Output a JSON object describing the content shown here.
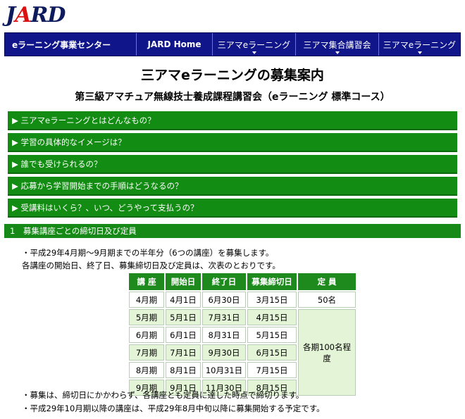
{
  "logo": "JARD",
  "nav": {
    "brand": "eラーニング事業センター",
    "items": [
      "JARD Home",
      "三アマeラーニング",
      "三アマ集合講習会",
      "三アマeラーニング"
    ]
  },
  "title": "三アマeラーニングの募集案内",
  "subtitle": "第三級アマチュア無線技士養成課程講習会（eラーニング 標準コース）",
  "accordion": [
    "▶ 三アマeラーニングとはどんなもの？",
    "▶ 学習の具体的なイメージは？",
    "▶ 誰でも受けられるの？",
    "▶ 応募から学習開始までの手順はどうなるの？",
    "▶ 受講料はいくら？、いつ、どうやって支払うの？"
  ],
  "section_title": "1　募集講座ごとの締切日及び定員",
  "intro": [
    "・平成29年4月期〜9月期までの半年分（6つの講座）を募集します。",
    "各講座の開始日、終了日、募集締切日及び定員は、次表のとおりです。"
  ],
  "table": {
    "headers": [
      "講 座",
      "開始日",
      "終了日",
      "募集締切日",
      "定 員"
    ],
    "rows": [
      [
        "4月期",
        "4月1日",
        "6月30日",
        "3月15日"
      ],
      [
        "5月期",
        "5月1日",
        "7月31日",
        "4月15日"
      ],
      [
        "6月期",
        "6月1日",
        "8月31日",
        "5月15日"
      ],
      [
        "7月期",
        "7月1日",
        "9月30日",
        "6月15日"
      ],
      [
        "8月期",
        "8月1日",
        "10月31日",
        "7月15日"
      ],
      [
        "9月期",
        "9月1日",
        "11月30日",
        "8月15日"
      ]
    ],
    "capacity_first": "50名",
    "capacity_rest": "各期100名程度"
  },
  "notes": [
    "・募集は、締切日にかかわらず、各講座とも定員に達した時点で締切ります。",
    "・平成29年10月期以降の講座は、平成29年8月中旬以降に募集開始する予定です。"
  ]
}
